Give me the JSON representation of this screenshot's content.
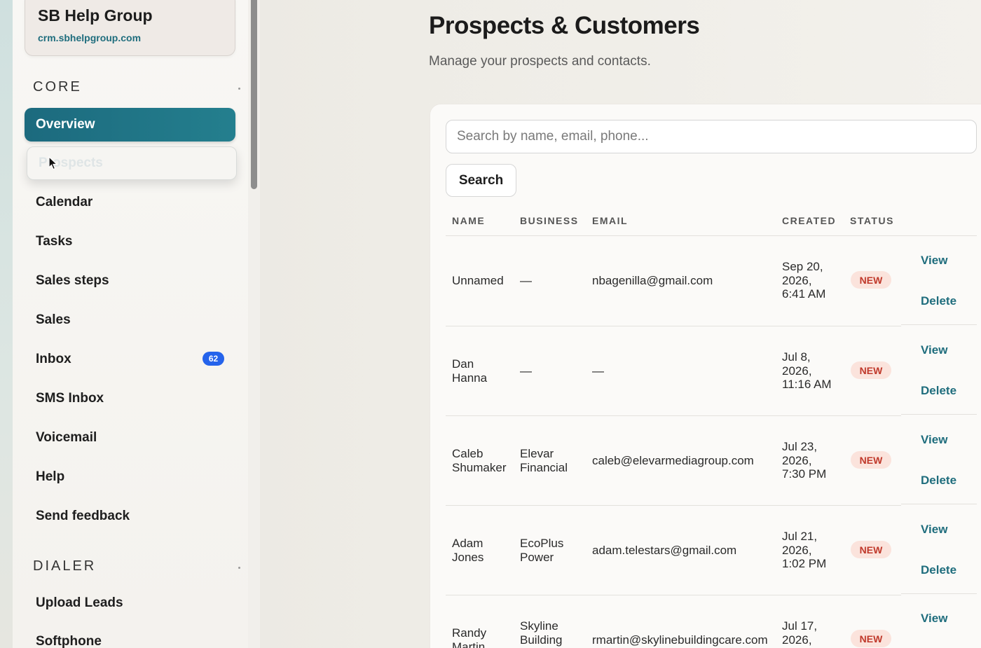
{
  "org": {
    "name": "SB Help Group",
    "url": "crm.sbhelpgroup.com"
  },
  "sidebar": {
    "sections": [
      {
        "label": "CORE"
      },
      {
        "label": "DIALER"
      }
    ],
    "core_items": [
      {
        "label": "Overview",
        "state": "active"
      },
      {
        "label": "Prospects",
        "state": "hovered"
      },
      {
        "label": "Calendar"
      },
      {
        "label": "Tasks"
      },
      {
        "label": "Sales steps"
      },
      {
        "label": "Sales"
      },
      {
        "label": "Inbox",
        "badge": "62"
      },
      {
        "label": "SMS Inbox"
      },
      {
        "label": "Voicemail"
      },
      {
        "label": "Help"
      },
      {
        "label": "Send feedback"
      }
    ],
    "dialer_items": [
      {
        "label": "Upload Leads"
      },
      {
        "label": "Softphone"
      }
    ]
  },
  "main": {
    "title": "Prospects & Customers",
    "subtitle": "Manage your prospects and contacts.",
    "search": {
      "placeholder": "Search by name, email, phone...",
      "button_label": "Search"
    },
    "table": {
      "columns": [
        "NAME",
        "BUSINESS",
        "EMAIL",
        "CREATED",
        "STATUS"
      ],
      "rows": [
        {
          "name_l1": "Unnamed",
          "name_l2": "",
          "business_l1": "—",
          "business_l2": "",
          "email": "nbagenilla@gmail.com",
          "created_l1": "Sep 20,",
          "created_l2": "2026,",
          "created_l3": "6:41 AM",
          "status": "NEW",
          "view": "View",
          "delete": "Delete"
        },
        {
          "name_l1": "Dan",
          "name_l2": "Hanna",
          "business_l1": "—",
          "business_l2": "",
          "email": "—",
          "created_l1": "Jul 8,",
          "created_l2": "2026,",
          "created_l3": "11:16 AM",
          "status": "NEW",
          "view": "View",
          "delete": "Delete"
        },
        {
          "name_l1": "Caleb",
          "name_l2": "Shumaker",
          "business_l1": "Elevar",
          "business_l2": "Financial",
          "email": "caleb@elevarmediagroup.com",
          "created_l1": "Jul 23,",
          "created_l2": "2026,",
          "created_l3": "7:30 PM",
          "status": "NEW",
          "view": "View",
          "delete": "Delete"
        },
        {
          "name_l1": "Adam",
          "name_l2": "Jones",
          "business_l1": "EcoPlus",
          "business_l2": "Power",
          "email": "adam.telestars@gmail.com",
          "created_l1": "Jul 21,",
          "created_l2": "2026,",
          "created_l3": "1:02 PM",
          "status": "NEW",
          "view": "View",
          "delete": "Delete"
        },
        {
          "name_l1": "Randy",
          "name_l2": "Martin",
          "business_l1": "Skyline",
          "business_l2": "Building",
          "email": "rmartin@skylinebuildingcare.com",
          "created_l1": "Jul 17,",
          "created_l2": "2026,",
          "created_l3": "",
          "status": "NEW",
          "view": "View",
          "delete": "Delete"
        }
      ]
    }
  },
  "colors": {
    "accent": "#1c6a7e",
    "link": "#1f6d7d",
    "badge": "#2563eb",
    "status_text": "#c0392b",
    "status_bg": "#fbe3dc"
  }
}
